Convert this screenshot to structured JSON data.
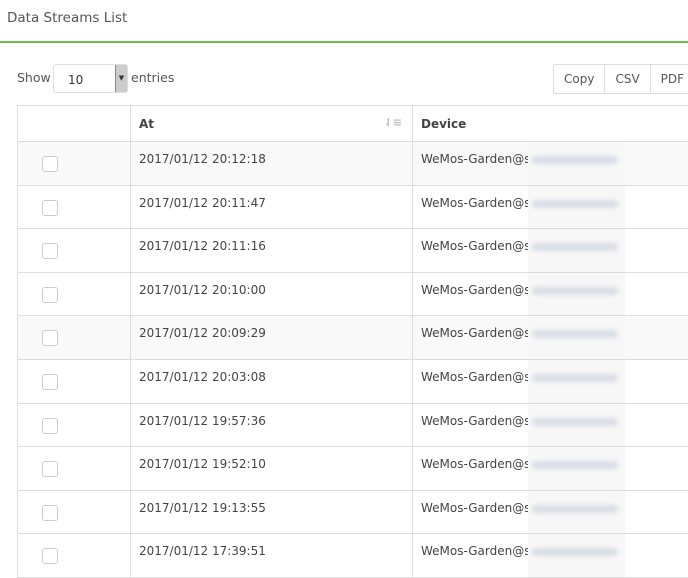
{
  "page": {
    "title": "Data Streams List"
  },
  "length": {
    "show_label": "Show",
    "value": "10",
    "entries_label": "entries"
  },
  "export_buttons": [
    "Copy",
    "CSV",
    "PDF"
  ],
  "table": {
    "headers": [
      "",
      "At",
      "Device"
    ],
    "rows": [
      {
        "at": "2017/01/12 20:12:18",
        "device": "WeMos-Garden@s"
      },
      {
        "at": "2017/01/12 20:11:47",
        "device": "WeMos-Garden@s"
      },
      {
        "at": "2017/01/12 20:11:16",
        "device": "WeMos-Garden@s"
      },
      {
        "at": "2017/01/12 20:10:00",
        "device": "WeMos-Garden@s"
      },
      {
        "at": "2017/01/12 20:09:29",
        "device": "WeMos-Garden@s"
      },
      {
        "at": "2017/01/12 20:03:08",
        "device": "WeMos-Garden@s"
      },
      {
        "at": "2017/01/12 19:57:36",
        "device": "WeMos-Garden@s"
      },
      {
        "at": "2017/01/12 19:52:10",
        "device": "WeMos-Garden@s"
      },
      {
        "at": "2017/01/12 19:13:55",
        "device": "WeMos-Garden@s"
      },
      {
        "at": "2017/01/12 17:39:51",
        "device": "WeMos-Garden@s"
      }
    ]
  },
  "colors": {
    "accent": "#6cc04a"
  }
}
